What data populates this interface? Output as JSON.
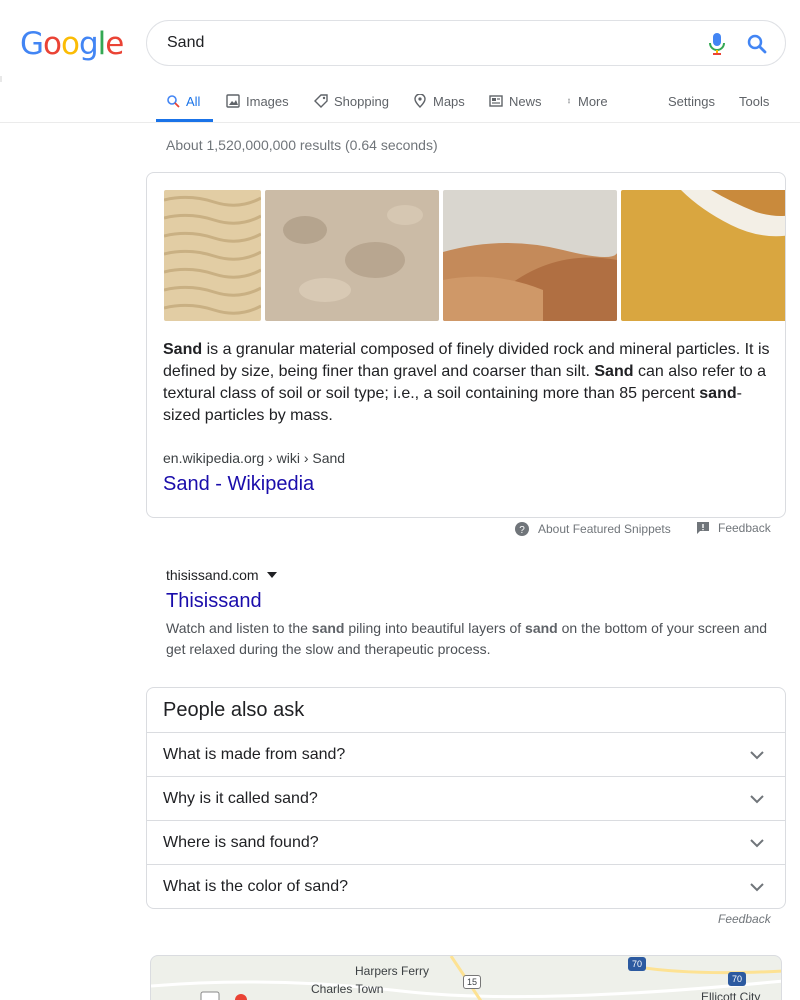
{
  "header": {
    "logo_text": "Google",
    "query": "Sand"
  },
  "tabs": [
    {
      "label": "All",
      "icon": "search-icon",
      "active": true
    },
    {
      "label": "Images",
      "icon": "image-icon"
    },
    {
      "label": "Shopping",
      "icon": "tag-icon"
    },
    {
      "label": "Maps",
      "icon": "map-pin-icon"
    },
    {
      "label": "News",
      "icon": "newspaper-icon"
    },
    {
      "label": "More",
      "icon": "kebab-icon"
    }
  ],
  "tools": {
    "settings": "Settings",
    "tools": "Tools"
  },
  "stats": "About 1,520,000,000 results (0.64 seconds)",
  "featured_snippet": {
    "images": [
      "sand-ripples-image",
      "sand-texture-image",
      "sand-dunes-image",
      "beach-wave-image"
    ],
    "text": {
      "p1_bold": "Sand",
      "p1": " is a granular material composed of finely divided rock and mineral particles. It is defined by size, being finer than gravel and coarser than silt. ",
      "p2_bold": "Sand",
      "p2": " can also refer to a textural class of soil or soil type; i.e., a soil containing more than 85 percent ",
      "p3_bold": "sand",
      "p3": "-sized particles by mass."
    },
    "cite": "en.wikipedia.org › wiki › Sand",
    "link_title": "Sand - Wikipedia"
  },
  "snippet_meta": {
    "about": "About Featured Snippets",
    "feedback": "Feedback"
  },
  "result": {
    "cite": "thisissand.com",
    "title": "Thisissand",
    "snippet_a": "Watch and listen to the ",
    "snippet_b1": "sand",
    "snippet_c": " piling into beautiful layers of ",
    "snippet_b2": "sand",
    "snippet_d": " on the bottom of your screen and get relaxed during the slow and therapeutic process."
  },
  "people_also_ask": {
    "title": "People also ask",
    "questions": [
      "What is made from sand?",
      "Why is it called sand?",
      "Where is sand found?",
      "What is the color of sand?"
    ],
    "feedback": "Feedback"
  },
  "map": {
    "labels": [
      "Harpers Ferry",
      "Charles Town",
      "Ellicott City"
    ],
    "shields": [
      "15",
      "70",
      "70"
    ]
  },
  "colors": {
    "accent": "#1a73e8",
    "link": "#1a0dab",
    "muted": "#70757a"
  }
}
